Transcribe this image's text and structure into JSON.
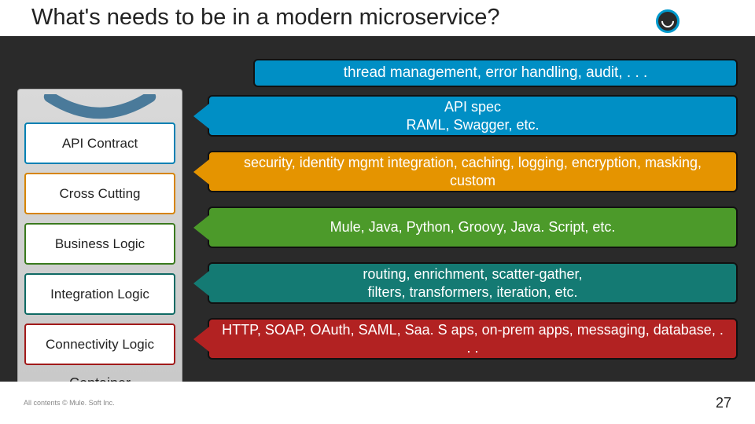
{
  "header": {
    "title": "What's needs to be in a modern microservice?",
    "brand": "MuleSoft"
  },
  "top_banner": "thread management, error handling, audit, . . .",
  "container_label": "Container",
  "layers": [
    {
      "id": "api-contract",
      "label": "API Contract",
      "desc": "API spec\nRAML, Swagger, etc."
    },
    {
      "id": "cross-cutting",
      "label": "Cross Cutting",
      "desc": "security, identity mgmt integration, caching, logging, encryption, masking, custom"
    },
    {
      "id": "business",
      "label": "Business Logic",
      "desc": "Mule, Java, Python, Groovy, Java. Script, etc."
    },
    {
      "id": "integration",
      "label": "Integration Logic",
      "desc": "routing, enrichment, scatter-gather,\nfilters, transformers, iteration, etc."
    },
    {
      "id": "connectivity",
      "label": "Connectivity Logic",
      "desc": "HTTP, SOAP, OAuth, SAML, Saa. S aps, on-prem apps, messaging, database, . . ."
    }
  ],
  "footer": {
    "copyright": "All contents © Mule. Soft Inc.",
    "page": "27"
  }
}
